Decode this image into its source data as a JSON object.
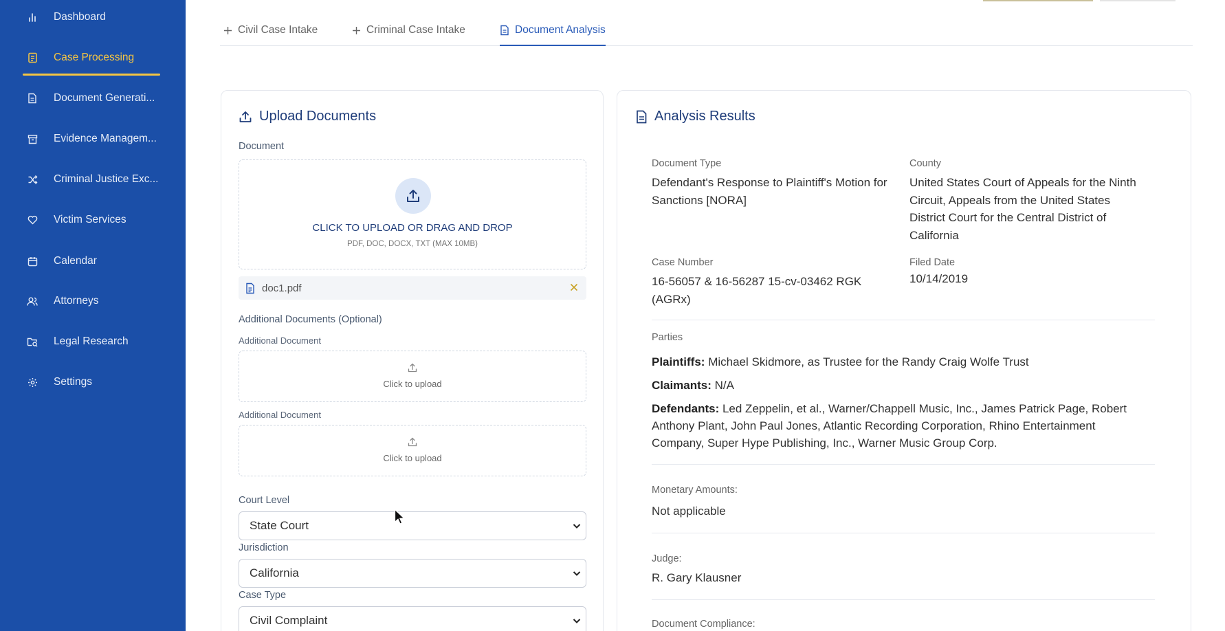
{
  "sidebar": {
    "items": [
      {
        "label": "Dashboard",
        "icon": "bar-chart-icon"
      },
      {
        "label": "Case Processing",
        "icon": "clipboard-icon",
        "active": true
      },
      {
        "label": "Document Generati...",
        "icon": "document-icon"
      },
      {
        "label": "Evidence Managem...",
        "icon": "archive-box-icon"
      },
      {
        "label": "Criminal Justice Exc...",
        "icon": "shuffle-icon"
      },
      {
        "label": "Victim Services",
        "icon": "heart-icon"
      },
      {
        "label": "Calendar",
        "icon": "calendar-icon"
      },
      {
        "label": "Attorneys",
        "icon": "users-icon"
      },
      {
        "label": "Legal Research",
        "icon": "folder-search-icon"
      },
      {
        "label": "Settings",
        "icon": "gear-icon"
      }
    ]
  },
  "tabs": [
    {
      "label": "Civil Case Intake",
      "icon": "plus-icon"
    },
    {
      "label": "Criminal Case Intake",
      "icon": "plus-icon"
    },
    {
      "label": "Document Analysis",
      "icon": "document-icon",
      "active": true
    }
  ],
  "upload": {
    "title": "Upload Documents",
    "document_label": "Document",
    "dropzone_title": "CLICK TO UPLOAD OR DRAG AND DROP",
    "dropzone_sub": "PDF, DOC, DOCX, TXT (MAX 10MB)",
    "file_name": "doc1.pdf",
    "additional_label": "Additional Documents (Optional)",
    "additional_items": [
      {
        "label": "Additional Document",
        "text": "Click to upload"
      },
      {
        "label": "Additional Document",
        "text": "Click to upload"
      }
    ],
    "court_level_label": "Court Level",
    "court_level_value": "State Court",
    "jurisdiction_label": "Jurisdiction",
    "jurisdiction_value": "California",
    "case_type_label": "Case Type",
    "case_type_value": "Civil Complaint"
  },
  "results": {
    "title": "Analysis Results",
    "document_type_label": "Document Type",
    "document_type_value": "Defendant's Response to Plaintiff's Motion for Sanctions [NORA]",
    "county_label": "County",
    "county_value": "United States Court of Appeals for the Ninth Circuit, Appeals from the United States District Court for the Central District of California",
    "case_number_label": "Case Number",
    "case_number_value": "16-56057 & 16-56287 15-cv-03462 RGK (AGRx)",
    "filed_date_label": "Filed Date",
    "filed_date_value": "10/14/2019",
    "parties_label": "Parties",
    "plaintiffs_label": "Plaintiffs:",
    "plaintiffs_value": "Michael Skidmore, as Trustee for the Randy Craig Wolfe Trust",
    "claimants_label": "Claimants:",
    "claimants_value": "N/A",
    "defendants_label": "Defendants:",
    "defendants_value": "Led Zeppelin, et al., Warner/Chappell Music, Inc., James Patrick Page, Robert Anthony Plant, John Paul Jones, Atlantic Recording Corporation, Rhino Entertainment Company, Super Hype Publishing, Inc., Warner Music Group Corp.",
    "monetary_label": "Monetary Amounts:",
    "monetary_value": "Not applicable",
    "judge_label": "Judge:",
    "judge_value": "R. Gary Klausner",
    "compliance_label": "Document Compliance:"
  },
  "colors": {
    "sidebar_bg": "#1b4fa8",
    "active_accent": "#f5c542",
    "brand_blue": "#2a5bb8",
    "title_navy": "#1f3d7a"
  }
}
